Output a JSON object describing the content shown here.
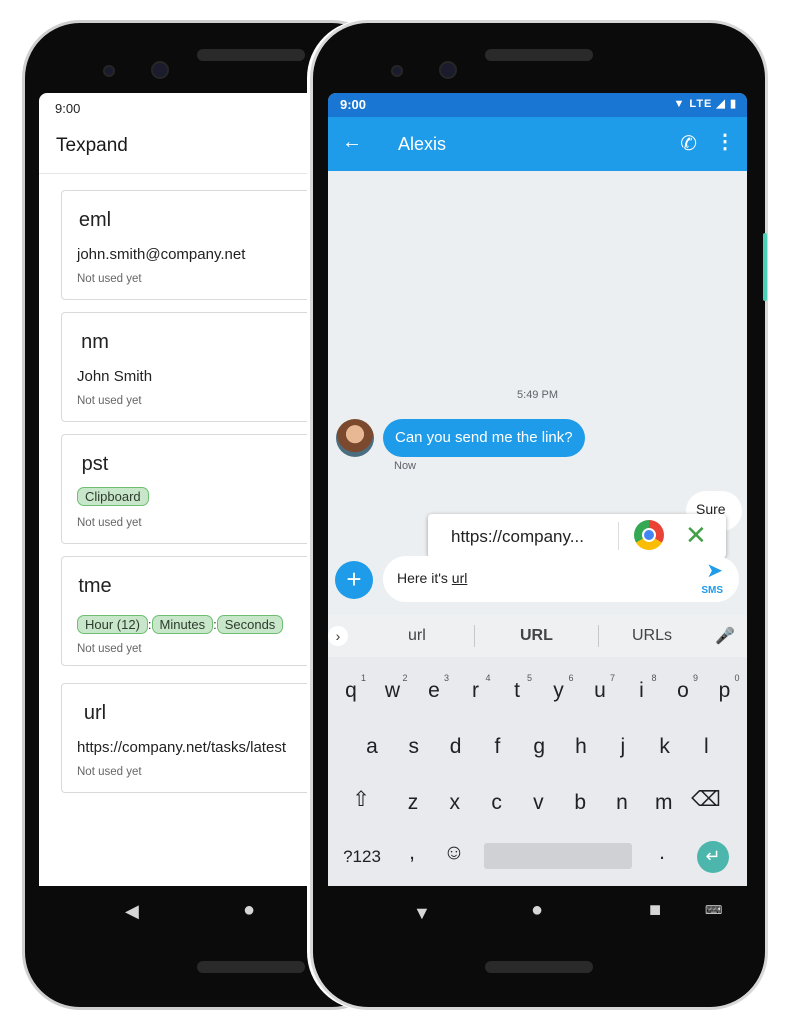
{
  "left_phone": {
    "status_time": "9:00",
    "app_title": "Texpand",
    "cards": [
      {
        "key": "eml",
        "value": "john.smith@company.net",
        "meta": "Not used yet"
      },
      {
        "key": "nm",
        "value": "John Smith",
        "meta": "Not used yet"
      },
      {
        "key": "pst",
        "chips": [
          "Clipboard"
        ],
        "meta": "Not used yet"
      },
      {
        "key": "tme",
        "chips": [
          "Hour (12)",
          "Minutes",
          "Seconds"
        ],
        "separator": ":",
        "meta": "Not used yet"
      },
      {
        "key": "url",
        "value": "https://company.net/tasks/latest",
        "meta": "Not used yet"
      }
    ]
  },
  "right_phone": {
    "status_time": "9:00",
    "status_icons": "▼ LTE ◢ ▮",
    "contact_name": "Alexis",
    "timestamp": "5:49 PM",
    "incoming_message": "Can you send me the link?",
    "incoming_time": "Now",
    "outgoing_message": "Sure",
    "suggestion_url": "https://company...",
    "compose_text": "Here it's ",
    "compose_underlined": "url",
    "send_label": "SMS",
    "keyboard": {
      "suggestions": [
        "url",
        "URL",
        "URLs"
      ],
      "row1": [
        "q",
        "w",
        "e",
        "r",
        "t",
        "y",
        "u",
        "i",
        "o",
        "p"
      ],
      "row1_numbers": [
        "1",
        "2",
        "3",
        "4",
        "5",
        "6",
        "7",
        "8",
        "9",
        "0"
      ],
      "row2": [
        "a",
        "s",
        "d",
        "f",
        "g",
        "h",
        "j",
        "k",
        "l"
      ],
      "row3": [
        "z",
        "x",
        "c",
        "v",
        "b",
        "n",
        "m"
      ],
      "symbols_key": "?123",
      "comma": ",",
      "period": "."
    }
  },
  "colors": {
    "primary": "#1e9be9",
    "status": "#1976d2",
    "chip_bg": "#c8e6c9",
    "enter": "#4db6ac"
  }
}
